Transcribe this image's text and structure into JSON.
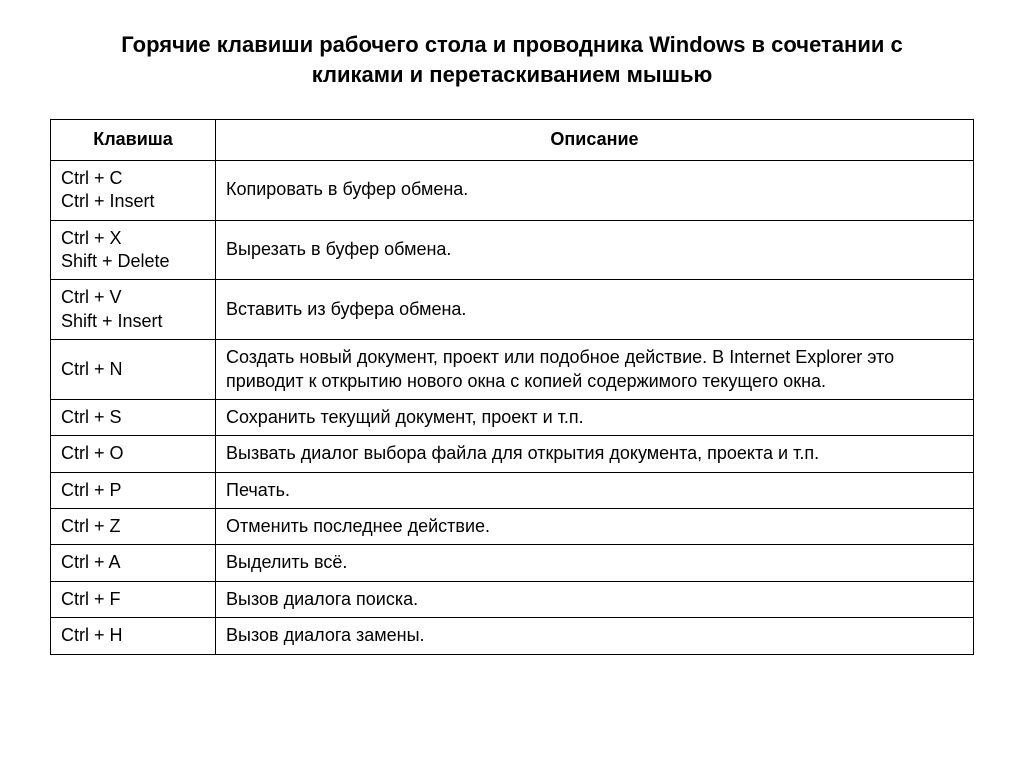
{
  "title": "Горячие клавиши рабочего стола и проводника Windows в сочетании с кликами и перетаскиванием мышью",
  "headers": {
    "key": "Клавиша",
    "desc": "Описание"
  },
  "rows": [
    {
      "key": "Ctrl + C\nCtrl + Insert",
      "desc": "Копировать в буфер обмена."
    },
    {
      "key": "Ctrl + X\nShift + Delete",
      "desc": "Вырезать в буфер обмена."
    },
    {
      "key": "Ctrl + V\nShift + Insert",
      "desc": "Вставить из буфера обмена."
    },
    {
      "key": "Ctrl + N",
      "desc": "Создать новый документ, проект или подобное действие. В Internet Explorer это приводит к открытию нового окна с копией содержимого текущего окна."
    },
    {
      "key": "Ctrl + S",
      "desc": "Сохранить текущий документ, проект и т.п."
    },
    {
      "key": "Ctrl + O",
      "desc": "Вызвать диалог выбора файла для открытия документа, проекта и т.п."
    },
    {
      "key": "Ctrl + P",
      "desc": "Печать."
    },
    {
      "key": "Ctrl + Z",
      "desc": "Отменить последнее действие."
    },
    {
      "key": "Ctrl + A",
      "desc": "Выделить всё."
    },
    {
      "key": "Ctrl + F",
      "desc": "Вызов диалога поиска."
    },
    {
      "key": "Ctrl + H",
      "desc": "Вызов диалога замены."
    }
  ]
}
